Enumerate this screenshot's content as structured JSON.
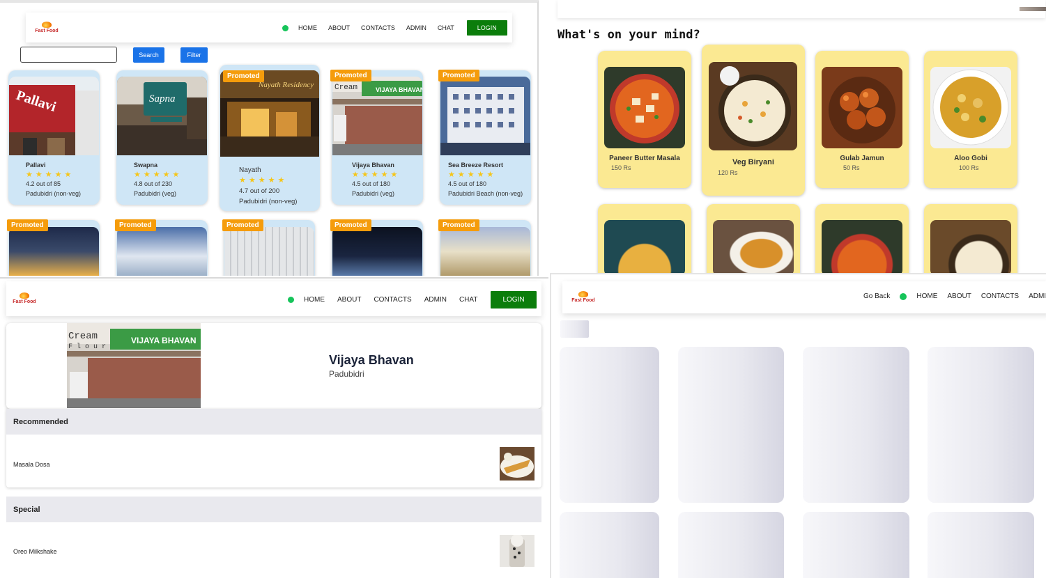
{
  "logo_text": "Fast Food",
  "nav": {
    "home": "HOME",
    "about": "ABOUT",
    "contacts": "CONTACTS",
    "admin": "ADMIN",
    "admin_cut": "ADMI",
    "chat": "CHAT",
    "login": "LOGIN",
    "go_back": "Go Back"
  },
  "listing": {
    "search_button": "Search",
    "filter_button": "Filter",
    "promo_label": "Promoted",
    "restaurants": [
      {
        "name": "Pallavi",
        "rating": "4.2 out of 85",
        "location": "Padubidri (non-veg)",
        "stars": "★★★★★",
        "promoted": false
      },
      {
        "name": "Swapna",
        "rating": "4.8 out of 230",
        "location": "Padubidri (veg)",
        "stars": "★★★★★",
        "promoted": false
      },
      {
        "name": "Nayath",
        "rating": "4.7 out of 200",
        "location": "Padubidri (non-veg)",
        "stars": "★★★★★",
        "promoted": true
      },
      {
        "name": "Vijaya Bhavan",
        "rating": "4.5 out of 180",
        "location": "Padubidri (veg)",
        "stars": "★★★★★",
        "promoted": true
      },
      {
        "name": "Sea Breeze Resort",
        "rating": "4.5 out of 180",
        "location": "Padubidri Beach (non-veg)",
        "stars": "★★★★★",
        "promoted": true
      }
    ],
    "second_row_promoted_count": 5
  },
  "mind": {
    "heading": "What's on your mind?",
    "foods": [
      {
        "name": "Paneer Butter Masala",
        "price": "150 Rs"
      },
      {
        "name": "Veg Biryani",
        "price": "120 Rs"
      },
      {
        "name": "Gulab Jamun",
        "price": "50 Rs"
      },
      {
        "name": "Aloo Gobi",
        "price": "100 Rs"
      }
    ]
  },
  "detail": {
    "restaurant_name": "Vijaya Bhavan",
    "location": "Padubidri",
    "sections": [
      {
        "title": "Recommended",
        "item": "Masala Dosa"
      },
      {
        "title": "Special",
        "item": "Oreo Milkshake"
      }
    ]
  },
  "colors": {
    "accent_green": "#0b7d0b",
    "status_green": "#16c45a",
    "button_blue": "#1a73e8",
    "promo_orange": "#f59c0b",
    "card_blue": "#cfe6f6",
    "card_yellow": "#fbe992",
    "star_gold": "#f5c518"
  }
}
